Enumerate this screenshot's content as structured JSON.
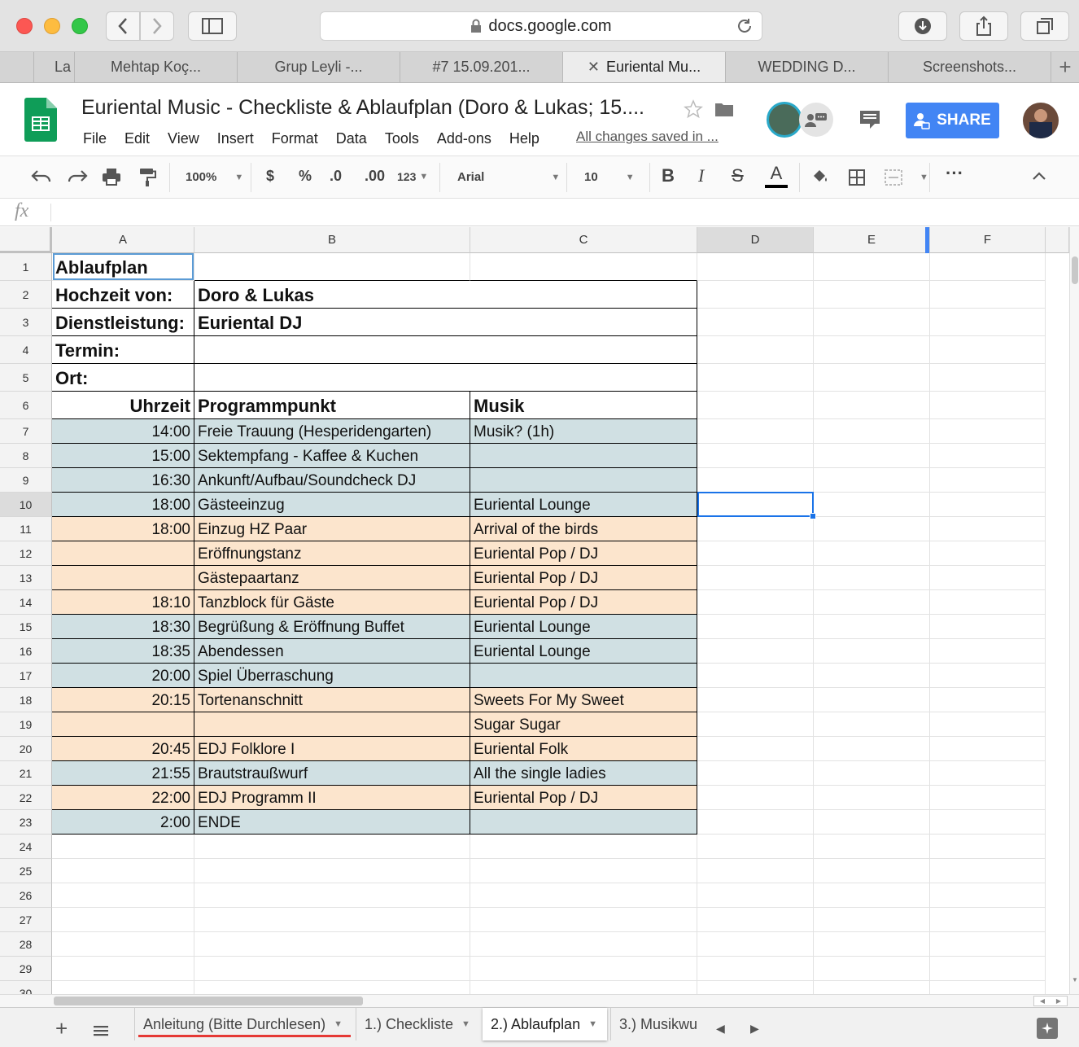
{
  "browser": {
    "url": "docs.google.com",
    "tabs": [
      "La",
      "Mehtap Koç...",
      "Grup Leyli -...",
      "#7 15.09.201...",
      "Euriental Mu...",
      "WEDDING D...",
      "Screenshots..."
    ],
    "active_tab": 4
  },
  "doc": {
    "title": "Euriental Music - Checkliste & Ablaufplan (Doro & Lukas; 15....",
    "menus": [
      "File",
      "Edit",
      "View",
      "Insert",
      "Format",
      "Data",
      "Tools",
      "Add-ons",
      "Help"
    ],
    "saved_status": "All changes saved in ...",
    "share_label": "SHARE"
  },
  "toolbar": {
    "zoom": "100%",
    "currency": "$",
    "percent": "%",
    "dec_less": ".0",
    "dec_more": ".00",
    "number_format": "123",
    "font": "Arial",
    "font_size": "10",
    "bold": "B",
    "italic": "I",
    "strike": "S",
    "text_color": "A",
    "more": "···"
  },
  "formula_bar": {
    "fx": "fx"
  },
  "columns": [
    "A",
    "B",
    "C",
    "D",
    "E",
    "F"
  ],
  "row_numbers": [
    "1",
    "2",
    "3",
    "4",
    "5",
    "6",
    "7",
    "8",
    "9",
    "10",
    "11",
    "12",
    "13",
    "14",
    "15",
    "16",
    "17",
    "18",
    "19",
    "20",
    "21",
    "22",
    "23",
    "24",
    "25",
    "26",
    "27",
    "28",
    "29",
    "30"
  ],
  "sheet": {
    "header_rows": [
      {
        "a": "Ablaufplan",
        "b": ""
      },
      {
        "a": "Hochzeit von:",
        "b": "Doro & Lukas"
      },
      {
        "a": "Dienstleistung:",
        "b": "Euriental DJ"
      },
      {
        "a": "Termin:",
        "b": ""
      },
      {
        "a": "Ort:",
        "b": ""
      }
    ],
    "table_header": {
      "time": "Uhrzeit",
      "program": "Programmpunkt",
      "music": "Musik"
    },
    "rows": [
      {
        "time": "14:00",
        "program": "Freie Trauung (Hesperidengarten)",
        "music": "Musik? (1h)",
        "color": "blue"
      },
      {
        "time": "15:00",
        "program": "Sektempfang - Kaffee & Kuchen",
        "music": "",
        "color": "blue"
      },
      {
        "time": "16:30",
        "program": "Ankunft/Aufbau/Soundcheck DJ",
        "music": "",
        "color": "blue"
      },
      {
        "time": "18:00",
        "program": "Gästeeinzug",
        "music": "Euriental Lounge",
        "color": "blue"
      },
      {
        "time": "18:00",
        "program": "Einzug HZ Paar",
        "music": "Arrival of the birds",
        "color": "orange"
      },
      {
        "time": "",
        "program": "Eröffnungstanz",
        "music": "Euriental Pop / DJ",
        "color": "orange"
      },
      {
        "time": "",
        "program": "Gästepaartanz",
        "music": "Euriental Pop / DJ",
        "color": "orange"
      },
      {
        "time": "18:10",
        "program": "Tanzblock für Gäste",
        "music": "Euriental Pop / DJ",
        "color": "orange"
      },
      {
        "time": "18:30",
        "program": "Begrüßung & Eröffnung Buffet",
        "music": "Euriental Lounge",
        "color": "blue"
      },
      {
        "time": "18:35",
        "program": "Abendessen",
        "music": "Euriental Lounge",
        "color": "blue"
      },
      {
        "time": "20:00",
        "program": "Spiel Überraschung",
        "music": "",
        "color": "blue"
      },
      {
        "time": "20:15",
        "program": "Tortenanschnitt",
        "music": "Sweets For My Sweet",
        "color": "orange"
      },
      {
        "time": "",
        "program": "",
        "music": "Sugar Sugar",
        "color": "orange"
      },
      {
        "time": "20:45",
        "program": "EDJ Folklore I",
        "music": "Euriental Folk",
        "color": "orange"
      },
      {
        "time": "21:55",
        "program": "Brautstraußwurf",
        "music": "All the single ladies",
        "color": "blue"
      },
      {
        "time": "22:00",
        "program": "EDJ Programm II",
        "music": "Euriental Pop / DJ",
        "color": "orange"
      },
      {
        "time": "2:00",
        "program": "ENDE",
        "music": "",
        "color": "blue"
      }
    ],
    "colors": {
      "blue": "#d0e0e3",
      "orange": "#fce5cd",
      "selection": "#1a73e8"
    }
  },
  "sheet_tabs": [
    {
      "label": "Anleitung (Bitte Durchlesen)",
      "active": false
    },
    {
      "label": "1.) Checkliste",
      "active": false
    },
    {
      "label": "2.) Ablaufplan",
      "active": true
    },
    {
      "label": "3.) Musikwu",
      "active": false
    }
  ],
  "icons": [
    "sheets-logo-icon",
    "star-icon",
    "folder-icon",
    "comments-icon",
    "undo-icon",
    "redo-icon",
    "print-icon",
    "paint-format-icon",
    "fill-color-icon",
    "borders-icon",
    "merge-icon",
    "collapse-icon",
    "add-sheet-icon",
    "all-sheets-icon",
    "explore-icon"
  ]
}
